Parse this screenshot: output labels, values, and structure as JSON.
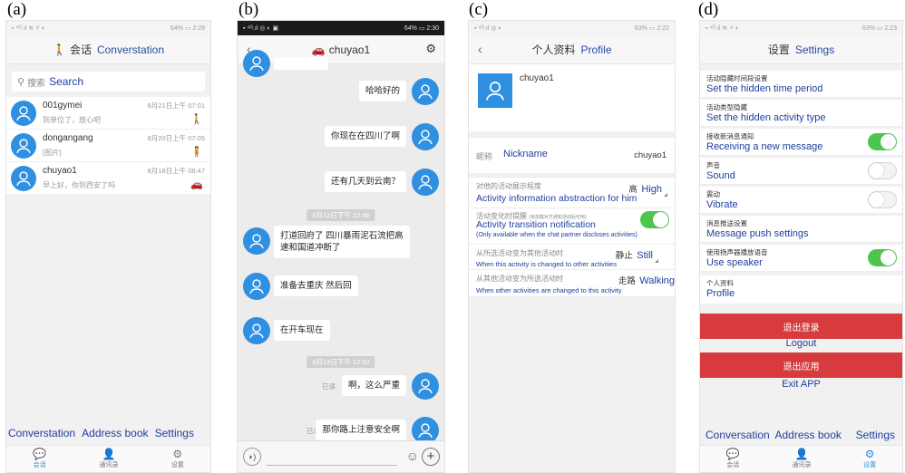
{
  "labels": {
    "a": "(a)",
    "b": "(b)",
    "c": "(c)",
    "d": "(d)"
  },
  "colors": {
    "accent": "#2f8fe0",
    "english_annotation": "#1f3f9c",
    "toggle_on": "#4cc64d",
    "danger": "#d73b3e"
  },
  "panel_a": {
    "status_left": "▪ ⁴ᴳ.ıl ≋ ⚡ ◐",
    "status_right": "64% ▭ 2:28",
    "title_cn": "会话",
    "title_en": "Converstation",
    "title_icon": "walking-person-icon",
    "search_cn": "搜索",
    "search_en": "Search",
    "conversations": [
      {
        "name": "001gymei",
        "preview": "到单位了，放心吧",
        "time": "8月21日上午 07:01",
        "activity_icon": "walking-icon"
      },
      {
        "name": "dongangang",
        "preview": "[图片]",
        "time": "8月20日上午 07:05",
        "activity_icon": "still-person-icon"
      },
      {
        "name": "chuyao1",
        "preview": "早上好，你到西安了吗",
        "time": "8月18日上午 08:47",
        "activity_icon": "car-icon"
      }
    ],
    "bottom_labels": [
      "Converstation",
      "Address book",
      "Settings"
    ],
    "nav": [
      "会话",
      "通讯录",
      "设置"
    ]
  },
  "panel_b": {
    "status_left": "▪ ⁴ᴳ.ıl ◎ ◐ ▣",
    "status_right": "64% ▭ 2:30",
    "title": "chuyao1",
    "title_icon": "car-icon",
    "messages_out_top": [
      "哈哈好的",
      "你现在在四川了啊",
      "还有几天到云南？"
    ],
    "timestamp1": "8月12日下午 12:46",
    "messages_in": [
      "打道回府了 四川暴雨泥石流把高\n速和国道冲断了",
      "准备去重庆 然后回",
      "在开车现在"
    ],
    "timestamp2": "8月13日下午 12:52",
    "read_mark": "已读",
    "messages_out_bottom": [
      "啊，这么严重",
      "那你路上注意安全啊"
    ]
  },
  "panel_c": {
    "status_left": "▪ ⁴ᴳ.ıl ◎ ◐",
    "status_right": "63% ▭ 2:22",
    "title_cn": "个人资料",
    "title_en": "Profile",
    "username": "chuyao1",
    "nickname_cn": "昵称",
    "nickname_en": "Nickname",
    "nickname_value": "chuyao1",
    "abstraction_cn": "对他的活动展示程度",
    "abstraction_en": "Activity information abstraction for him",
    "abstraction_value_cn": "高",
    "abstraction_value_en": "High",
    "transition_cn": "活动变化时提醒",
    "transition_note_cn": "(未加载对方通知活动后可用)",
    "transition_en": "Activity transition notification",
    "transition_note_en": "(Only available when the chat partner discloses activities)",
    "transition_on": true,
    "from_selected_cn": "从所选活动变为其他活动时",
    "from_selected_value_cn": "静止",
    "from_selected_value_en": "Still",
    "from_selected_en": "When this activity is changed to other activities",
    "to_selected_cn": "从其他活动变为所选活动时",
    "to_selected_value_cn": "走路",
    "to_selected_value_en": "Walking",
    "to_selected_en": "When other activities are changed to this activity"
  },
  "panel_d": {
    "status_left": "▪ ⁴ᴳ.ıl ≋ ⚡ ◐",
    "status_right": "63% ▭ 2:23",
    "title_cn": "设置",
    "title_en": "Settings",
    "rows": [
      {
        "cn": "活动隐藏时间段设置",
        "en": "Set the hidden time period",
        "toggle": null
      },
      {
        "cn": "活动类型隐藏",
        "en": "Set the hidden activity type",
        "toggle": null
      },
      {
        "cn": "接收新消息通知",
        "en": "Receiving a new message",
        "toggle": true
      },
      {
        "cn": "声音",
        "en": "Sound",
        "toggle": false
      },
      {
        "cn": "震动",
        "en": "Vibrate",
        "toggle": false
      },
      {
        "cn": "消息推送设置",
        "en": "Message push settings",
        "toggle": null
      },
      {
        "cn": "使用扬声器播放语音",
        "en": "Use speaker",
        "toggle": true
      },
      {
        "cn": "个人资料",
        "en": "Profile",
        "toggle": null
      }
    ],
    "logout_cn": "退出登录",
    "logout_en": "Logout",
    "exit_cn": "退出应用",
    "exit_en": "Exit APP",
    "bottom_labels": [
      "Conversation",
      "Address book",
      "Settings"
    ],
    "nav": [
      "会话",
      "通讯录",
      "设置"
    ]
  }
}
